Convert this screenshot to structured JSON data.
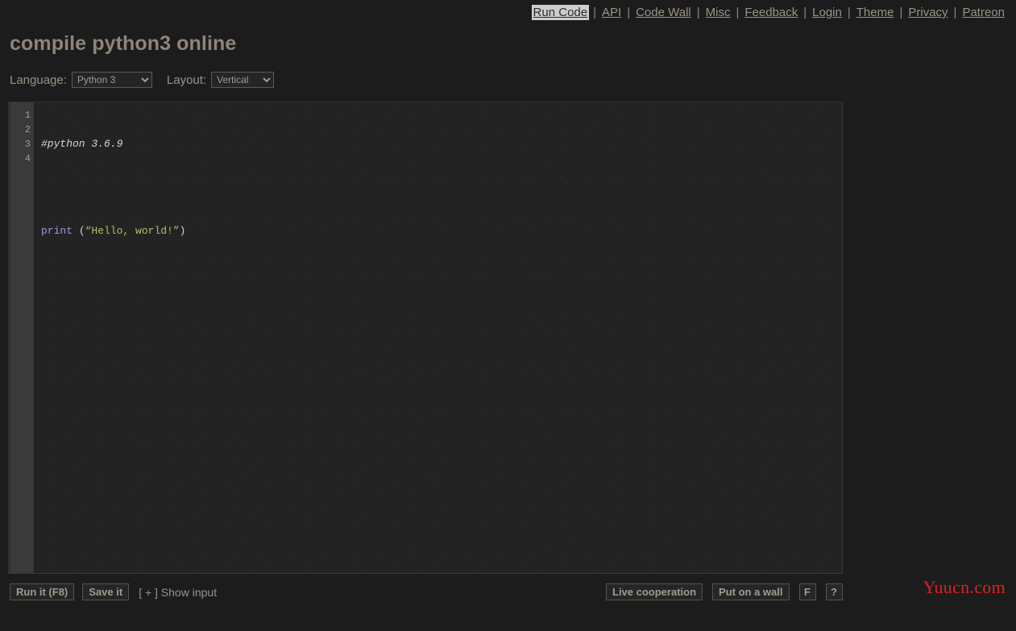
{
  "topnav": {
    "separator": "|",
    "items": [
      {
        "label": "Run Code",
        "active": true
      },
      {
        "label": "API",
        "active": false
      },
      {
        "label": "Code Wall",
        "active": false
      },
      {
        "label": "Misc",
        "active": false
      },
      {
        "label": "Feedback",
        "active": false
      },
      {
        "label": "Login",
        "active": false
      },
      {
        "label": "Theme",
        "active": false
      },
      {
        "label": "Privacy",
        "active": false
      },
      {
        "label": "Patreon",
        "active": false
      }
    ]
  },
  "header": {
    "title": "compile python3 online"
  },
  "controls": {
    "language_label": "Language:",
    "language_value": "Python 3",
    "language_options": [
      "Python 3"
    ],
    "layout_label": "Layout:",
    "layout_value": "Vertical",
    "layout_options": [
      "Vertical"
    ]
  },
  "editor": {
    "line_numbers": [
      "1",
      "2",
      "3",
      "4"
    ],
    "lines": [
      {
        "tokens": [
          {
            "text": "#python 3.6.9",
            "type": "comment"
          }
        ]
      },
      {
        "tokens": []
      },
      {
        "tokens": [
          {
            "text": "print",
            "type": "kw"
          },
          {
            "text": " (",
            "type": "punct"
          },
          {
            "text": "“Hello, world!”",
            "type": "str"
          },
          {
            "text": ")",
            "type": "punct"
          }
        ]
      },
      {
        "tokens": []
      }
    ]
  },
  "toolbar": {
    "run_label": "Run it (F8)",
    "save_label": "Save it",
    "show_input_label": "[ + ] Show input",
    "live_cooperation_label": "Live cooperation",
    "put_on_wall_label": "Put on a wall",
    "fullscreen_label": "F",
    "help_label": "?"
  },
  "watermark": {
    "text": "Yuucn.com"
  },
  "colors": {
    "page_bg": "#1c1c1c",
    "editor_bg": "#232323",
    "gutter_bg": "#3a3a3a",
    "link": "#9b9287",
    "active_link_bg": "#cdcdcd",
    "watermark": "#e31e24",
    "keyword": "#9a9ae0",
    "string": "#b5bd68",
    "comment": "#d6d6d6"
  }
}
